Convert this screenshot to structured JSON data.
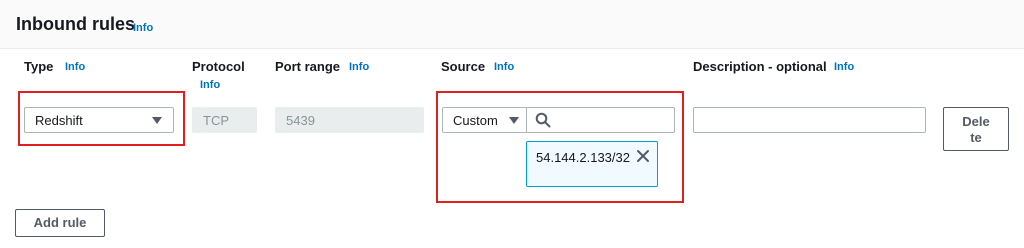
{
  "section": {
    "title": "Inbound rules",
    "info": "Info"
  },
  "columns": {
    "type": {
      "label": "Type",
      "info": "Info"
    },
    "protocol": {
      "label": "Protocol",
      "info": "Info"
    },
    "port_range": {
      "label": "Port range",
      "info": "Info"
    },
    "source": {
      "label": "Source",
      "info": "Info"
    },
    "description": {
      "label": "Description - optional",
      "info": "Info"
    }
  },
  "rule": {
    "type_value": "Redshift",
    "protocol_value": "TCP",
    "port_value": "5439",
    "source_select": "Custom",
    "source_search_placeholder": "",
    "source_token": "54.144.2.133/32",
    "description_value": "",
    "delete_label": "Delete"
  },
  "actions": {
    "add_rule_label": "Add rule"
  },
  "icons": {
    "type_dropdown": "caret-down-icon",
    "source_dropdown": "caret-down-icon",
    "search": "search-icon",
    "remove_token": "close-icon"
  },
  "colors": {
    "info_link": "#0073bb",
    "highlight": "#e02020",
    "token_border": "#00a1c9",
    "token_bg": "#f1faff"
  }
}
